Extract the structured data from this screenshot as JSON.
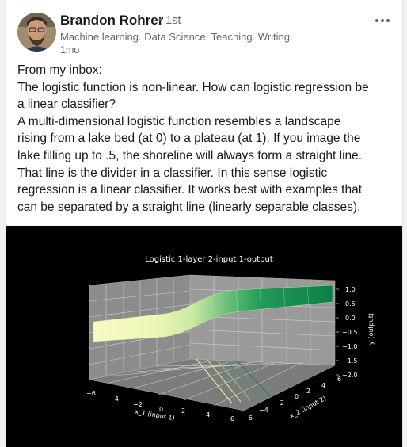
{
  "post": {
    "author": {
      "name": "Brandon Rohrer",
      "degree": "• 1st",
      "headline": "Machine learning. Data Science. Teaching. Writing.",
      "time": "1mo"
    },
    "more_icon": "ellipsis-icon",
    "text_lines": [
      "From my inbox:",
      "The logistic function is non-linear. How can logistic regression be",
      "a linear classifier?",
      "A multi-dimensional logistic function resembles a landscape",
      "rising from a lake bed (at 0) to a plateau (at 1). If you image the",
      "lake filling up to .5, the shoreline will always form a straight line.",
      "That line is the divider in a classifier. In this sense logistic",
      "regression is a linear classifier. It works best with examples that",
      "can be separated by a straight line (linearly separable classes)."
    ]
  },
  "figure": {
    "title": "Logistic 1-layer 2-input 1-output",
    "x1_label": "x_1 (input 1)",
    "x2_label": "x_2 (input 2)",
    "y_label": "y (output)",
    "x1_ticks": [
      "−6",
      "−4",
      "−2",
      "0",
      "2",
      "4",
      "6"
    ],
    "x2_ticks": [
      "−6",
      "−4",
      "−2",
      "0",
      "2",
      "4",
      "6"
    ],
    "y_ticks": [
      "1.0",
      "0.5",
      "0.0",
      "−0.5",
      "−1.0",
      "−1.5",
      "−2.0"
    ],
    "colors": {
      "background": "#000000",
      "pane": "#8e8e8e",
      "surface_low": "#f4f9c0",
      "surface_high": "#0a8a4c"
    }
  }
}
